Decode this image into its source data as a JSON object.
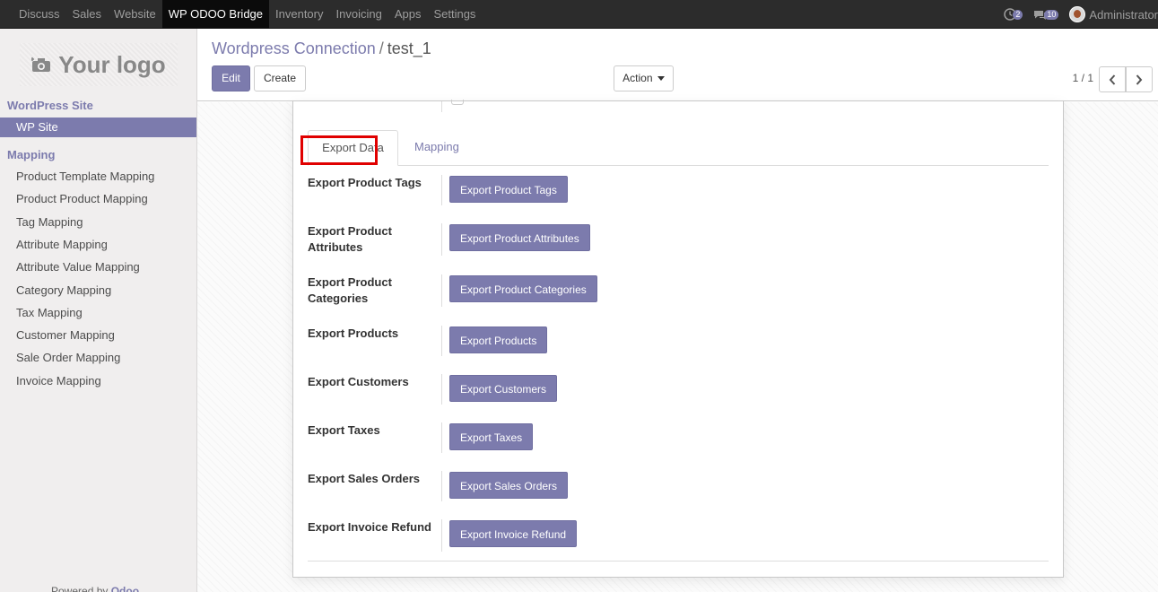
{
  "topbar": {
    "menu": [
      "Discuss",
      "Sales",
      "Website",
      "WP ODOO Bridge",
      "Inventory",
      "Invoicing",
      "Apps",
      "Settings"
    ],
    "active_menu": "WP ODOO Bridge",
    "activity_count": "2",
    "messages_count": "10",
    "user": "Administrator"
  },
  "sidebar": {
    "logo_text": "Your logo",
    "section1": "WordPress Site",
    "section1_items": [
      "WP Site"
    ],
    "section2": "Mapping",
    "section2_items": [
      "Product Template Mapping",
      "Product Product Mapping",
      "Tag Mapping",
      "Attribute Mapping",
      "Attribute Value Mapping",
      "Category Mapping",
      "Tax Mapping",
      "Customer Mapping",
      "Sale Order Mapping",
      "Invoice Mapping"
    ],
    "powered_prefix": "Powered by",
    "powered_brand": "Odoo"
  },
  "control": {
    "breadcrumb_parent": "Wordpress Connection",
    "breadcrumb_sep": "/",
    "breadcrumb_current": "test_1",
    "edit_label": "Edit",
    "create_label": "Create",
    "action_label": "Action",
    "pager": "1 / 1"
  },
  "form": {
    "tabs": [
      "Export Data",
      "Mapping"
    ],
    "rows": [
      {
        "label": "Export Product Tags",
        "button": "Export Product Tags"
      },
      {
        "label": "Export Product Attributes",
        "button": "Export Product Attributes"
      },
      {
        "label": "Export Product Categories",
        "button": "Export Product Categories"
      },
      {
        "label": "Export Products",
        "button": "Export Products"
      },
      {
        "label": "Export Customers",
        "button": "Export Customers"
      },
      {
        "label": "Export Taxes",
        "button": "Export Taxes"
      },
      {
        "label": "Export Sales Orders",
        "button": "Export Sales Orders"
      },
      {
        "label": "Export Invoice Refund",
        "button": "Export Invoice Refund"
      }
    ]
  },
  "colors": {
    "accent": "#7c7bad",
    "highlight": "#e00000",
    "navbar": "#2c2c2c"
  }
}
